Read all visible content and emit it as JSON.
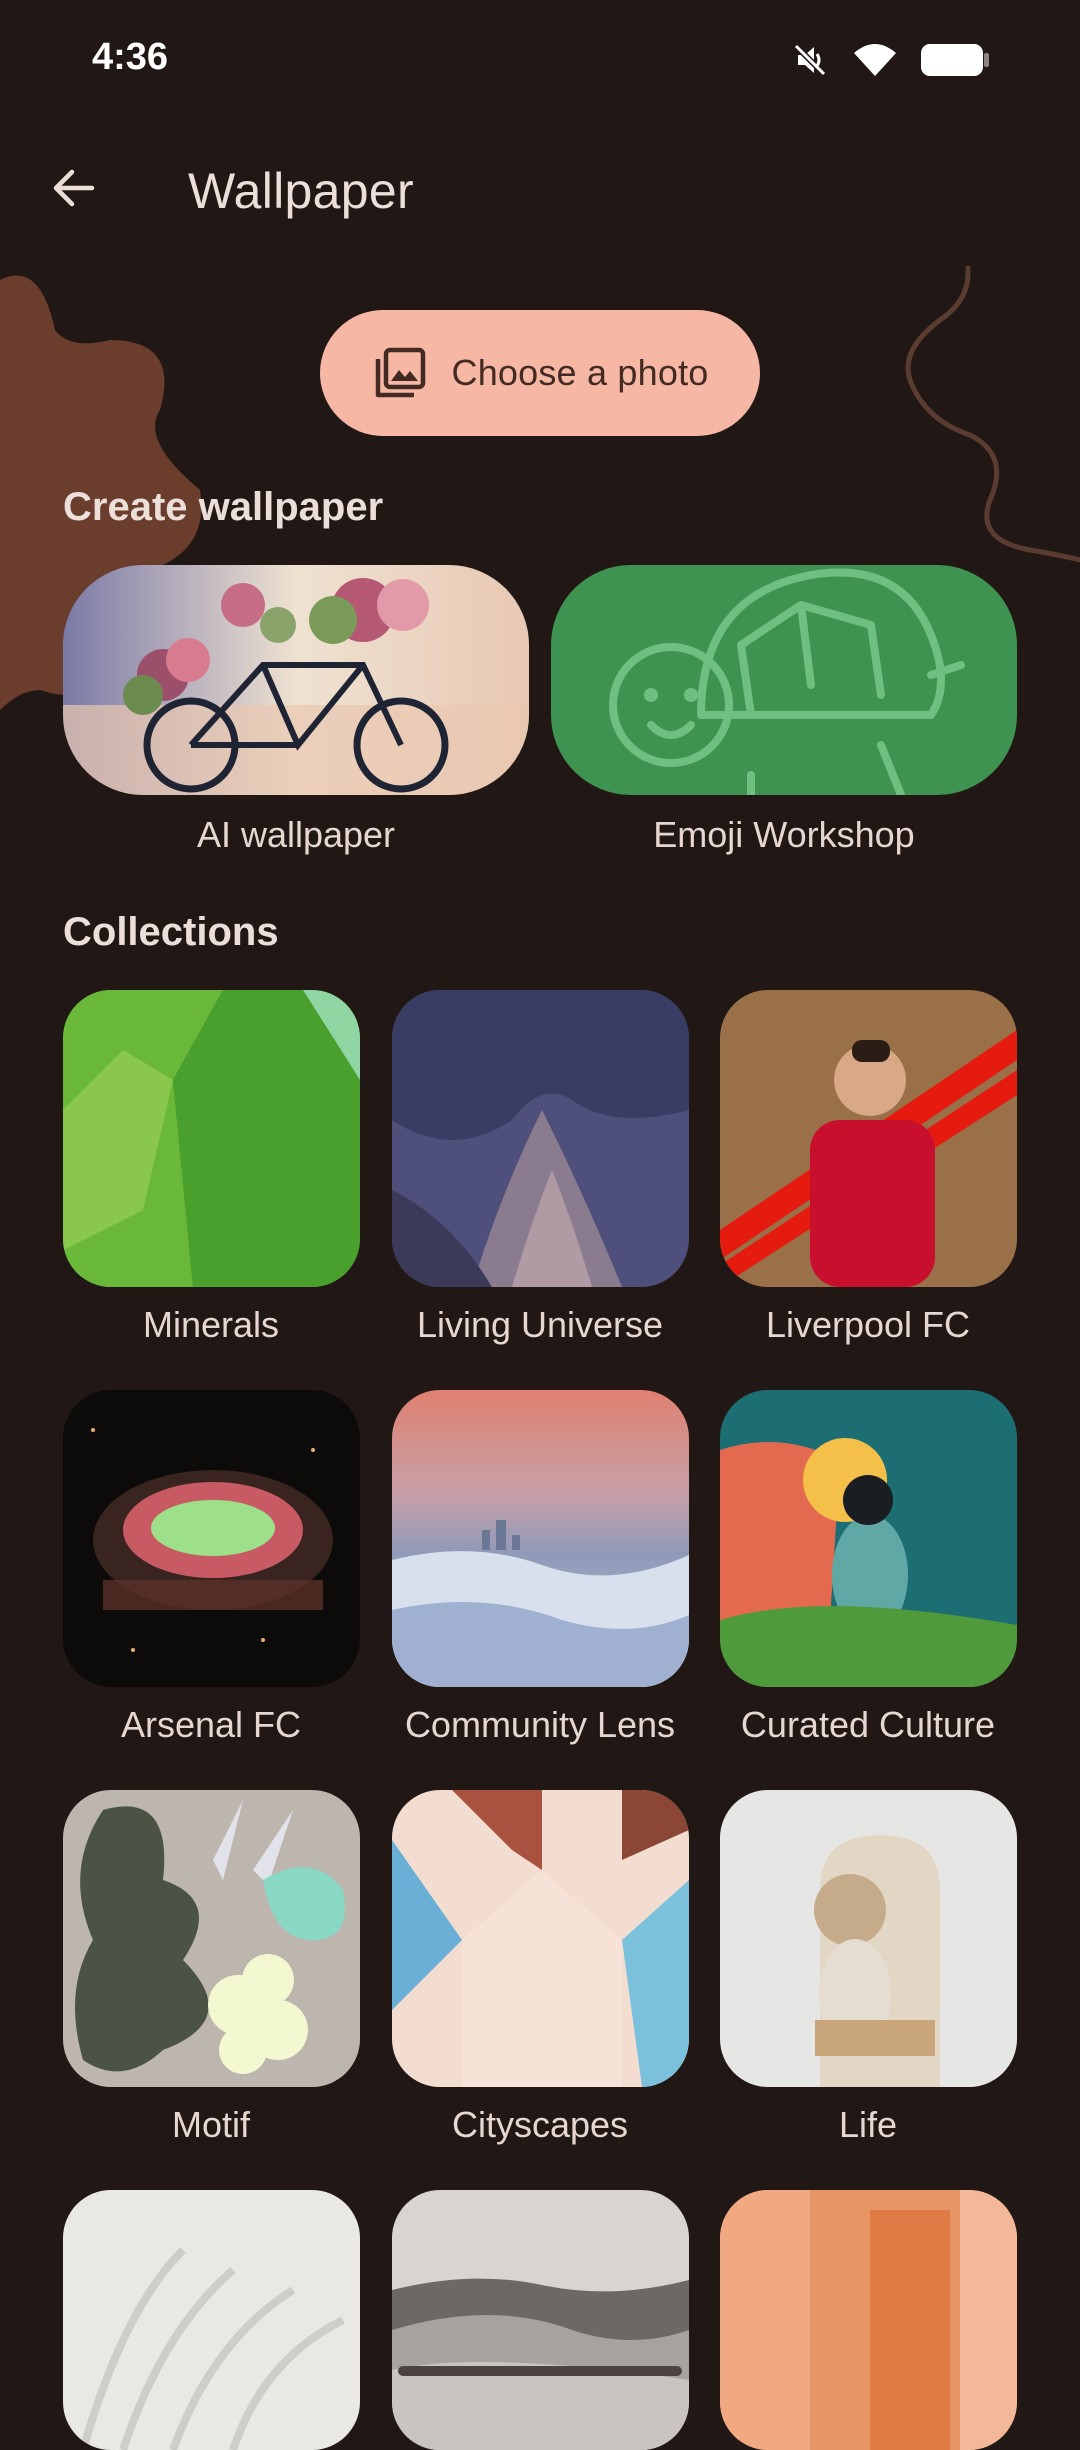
{
  "status_bar": {
    "time": "4:36",
    "icons": [
      "mute-icon",
      "wifi-icon",
      "battery-icon"
    ]
  },
  "header": {
    "title": "Wallpaper",
    "back_icon": "back-arrow-icon"
  },
  "choose_photo": {
    "label": "Choose a photo",
    "icon": "photo-library-icon"
  },
  "create_wallpaper": {
    "title": "Create wallpaper",
    "items": [
      {
        "label": "AI wallpaper"
      },
      {
        "label": "Emoji Workshop"
      }
    ]
  },
  "collections": {
    "title": "Collections",
    "items": [
      {
        "label": "Minerals"
      },
      {
        "label": "Living Universe"
      },
      {
        "label": "Liverpool FC"
      },
      {
        "label": "Arsenal FC"
      },
      {
        "label": "Community Lens"
      },
      {
        "label": "Curated Culture"
      },
      {
        "label": "Motif"
      },
      {
        "label": "Cityscapes"
      },
      {
        "label": "Life"
      }
    ]
  },
  "colors": {
    "background": "#211816",
    "button_accent": "#f6b8a4",
    "emoji_card": "#3f9350"
  }
}
